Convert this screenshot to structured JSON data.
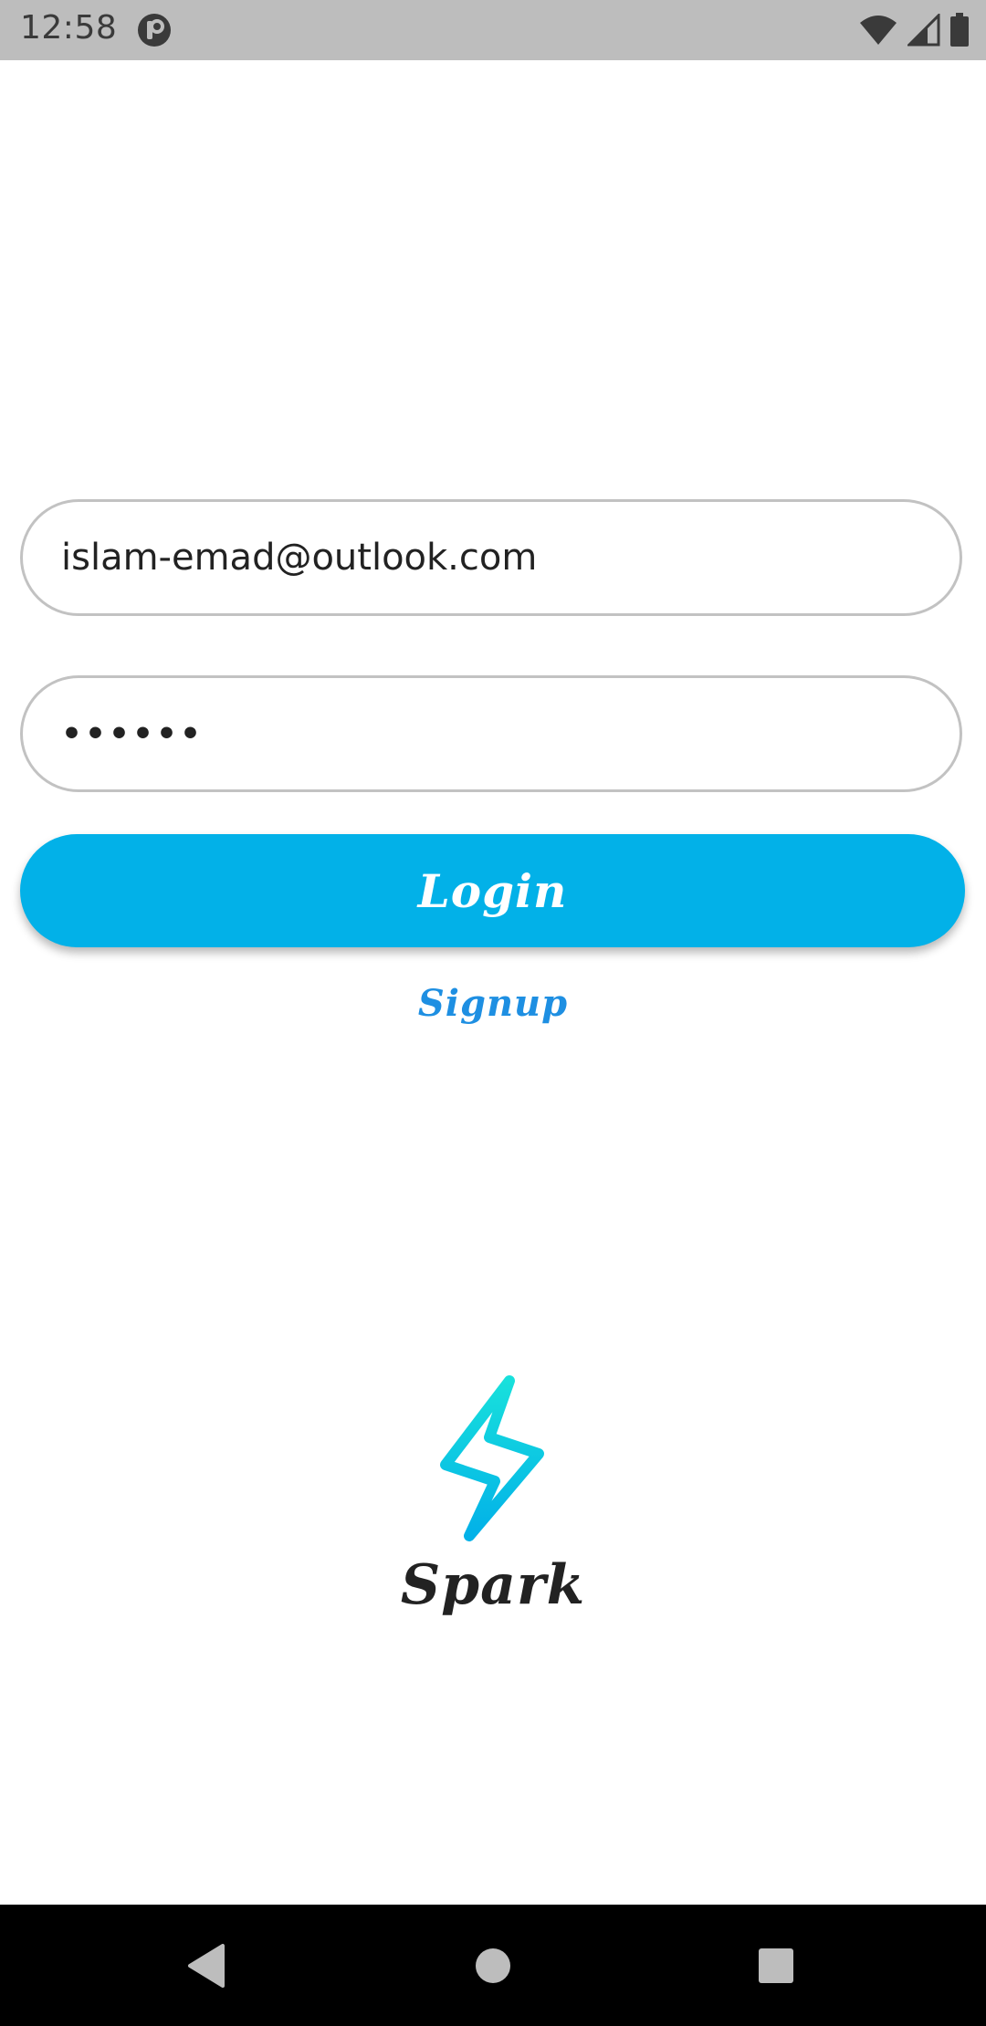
{
  "status_bar": {
    "time": "12:58",
    "icons": [
      "app-notification-icon",
      "wifi-icon",
      "cellular-signal-icon",
      "battery-icon"
    ]
  },
  "login_form": {
    "email_value": "islam-emad@outlook.com",
    "password_value": "••••••",
    "login_label": "Login",
    "signup_label": "Signup"
  },
  "branding": {
    "logo_icon": "lightning-bolt-icon",
    "name": "Spark"
  },
  "navigation_bar": {
    "buttons": [
      "back-icon",
      "home-icon",
      "recents-icon"
    ]
  },
  "colors": {
    "accent": "#02b1e8",
    "link": "#1e8fe2",
    "field_border": "#c2c2c2",
    "logo_gradient_start": "#18e0dc",
    "logo_gradient_end": "#02b1e8",
    "status_bar_bg": "#bdbdbd",
    "nav_bar_bg": "#000000"
  }
}
